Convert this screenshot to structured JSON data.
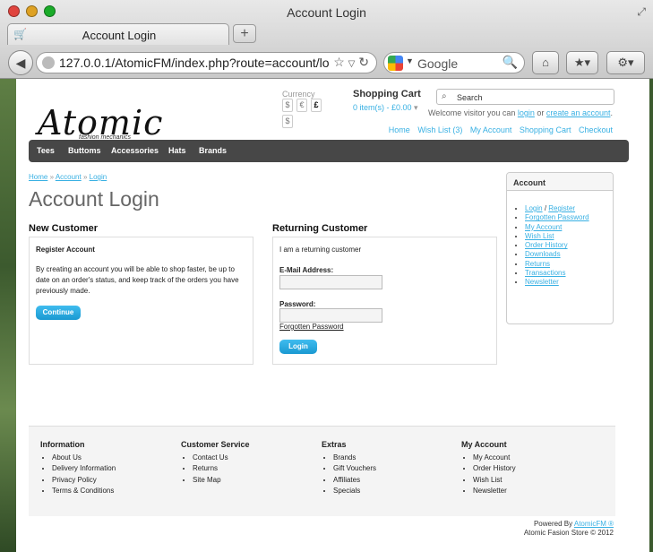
{
  "window": {
    "title": "Account Login"
  },
  "tab": {
    "label": "Account Login",
    "new_tab": "+"
  },
  "url": {
    "text": "127.0.0.1/AtomicFM/index.php?route=account/lo"
  },
  "search_engine": {
    "placeholder": "Google"
  },
  "store": {
    "logo_text": "Atomic",
    "logo_tagline": "fashion mechanics",
    "currency_label": "Currency",
    "currencies": [
      "$",
      "€",
      "£",
      "$"
    ],
    "cart_title": "Shopping Cart",
    "cart_summary": "0 item(s) - £0.00",
    "search_placeholder": "Search",
    "welcome": {
      "prefix": "Welcome visitor you can",
      "login": "login",
      "or": "or",
      "create": "create an account",
      "suffix": "."
    },
    "top_links": [
      "Home",
      "Wish List (3)",
      "My Account",
      "Shopping Cart",
      "Checkout"
    ],
    "menu": [
      "Tees",
      "Buttoms",
      "Accessories",
      "Hats",
      "Brands"
    ]
  },
  "breadcrumb": [
    "Home",
    "Account",
    "Login"
  ],
  "breadcrumb_sep": "»",
  "page_title": "Account Login",
  "new_customer": {
    "heading": "New Customer",
    "subheading": "Register Account",
    "text": "By creating an account you will be able to shop faster, be up to date on an order's status, and keep track of the orders you have previously made.",
    "button": "Continue"
  },
  "returning_customer": {
    "heading": "Returning Customer",
    "intro": "I am a returning customer",
    "email_label": "E-Mail Address:",
    "password_label": "Password:",
    "forgotten": "Forgotten Password",
    "button": "Login"
  },
  "account_box": {
    "heading": "Account",
    "login": "Login",
    "slash": "/",
    "register": "Register",
    "items": [
      "Forgotten Password",
      "My Account",
      "Wish List",
      "Order History",
      "Downloads",
      "Returns",
      "Transactions",
      "Newsletter"
    ]
  },
  "footer": {
    "columns": [
      {
        "title": "Information",
        "items": [
          "About Us",
          "Delivery Information",
          "Privacy Policy",
          "Terms & Conditions"
        ]
      },
      {
        "title": "Customer Service",
        "items": [
          "Contact Us",
          "Returns",
          "Site Map"
        ]
      },
      {
        "title": "Extras",
        "items": [
          "Brands",
          "Gift Vouchers",
          "Affiliates",
          "Specials"
        ]
      },
      {
        "title": "My Account",
        "items": [
          "My Account",
          "Order History",
          "Wish List",
          "Newsletter"
        ]
      }
    ],
    "powered_prefix": "Powered By",
    "powered_link": "AtomicFM ®",
    "copyright": "Atomic Fasion Store © 2012"
  }
}
